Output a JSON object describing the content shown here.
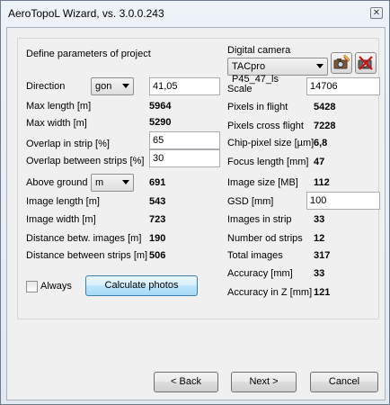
{
  "window": {
    "title": "AeroTopoL Wizard, vs. 3.0.0.243",
    "close_glyph": "✕"
  },
  "left": {
    "section_title": "Define parameters of project",
    "direction": {
      "label": "Direction",
      "unit": "gon",
      "value": "41,05"
    },
    "max_length": {
      "label": "Max length [m]",
      "value": "5964"
    },
    "max_width": {
      "label": "Max width [m]",
      "value": "5290"
    },
    "overlap_strip": {
      "label": "Overlap in strip [%]",
      "value": "65"
    },
    "overlap_between": {
      "label": "Overlap between strips [%]",
      "value": "30"
    },
    "above_ground": {
      "label": "Above ground",
      "unit": "m",
      "value": "691"
    },
    "image_length": {
      "label": "Image length [m]",
      "value": "543"
    },
    "image_width": {
      "label": "Image width [m]",
      "value": "723"
    },
    "distance_images": {
      "label": "Distance betw. images [m]",
      "value": "190"
    },
    "distance_strips": {
      "label": "Distance between strips [m]",
      "value": "506"
    },
    "always": {
      "label": "Always",
      "checked": false
    },
    "calculate_label": "Calculate photos"
  },
  "right": {
    "camera_label": "Digital camera",
    "camera_value": "TACpro P45_47_ls",
    "scale": {
      "label": "Scale",
      "value": "14706"
    },
    "pixels_flight": {
      "label": "Pixels in flight",
      "value": "5428"
    },
    "pixels_cross": {
      "label": "Pixels cross flight",
      "value": "7228"
    },
    "chip_pixel": {
      "label": "Chip-pixel size [µm]",
      "value": "6,8"
    },
    "focus_length": {
      "label": "Focus length [mm]",
      "value": "47"
    },
    "image_size": {
      "label": "Image size [MB]",
      "value": "112"
    },
    "gsd": {
      "label": "GSD [mm]",
      "value": "100"
    },
    "images_strip": {
      "label": "Images in  strip",
      "value": "33"
    },
    "number_strips": {
      "label": "Number od strips",
      "value": "12"
    },
    "total_images": {
      "label": "Total images",
      "value": "317"
    },
    "accuracy": {
      "label": "Accuracy [mm]",
      "value": "33"
    },
    "accuracy_z": {
      "label": "Accuracy in Z [mm]",
      "value": "121"
    }
  },
  "footer": {
    "back_label": "< Back",
    "next_label": "Next >",
    "cancel_label": "Cancel"
  },
  "icons": {
    "camera_edit": "camera-edit-icon",
    "camera_delete": "camera-delete-icon"
  }
}
